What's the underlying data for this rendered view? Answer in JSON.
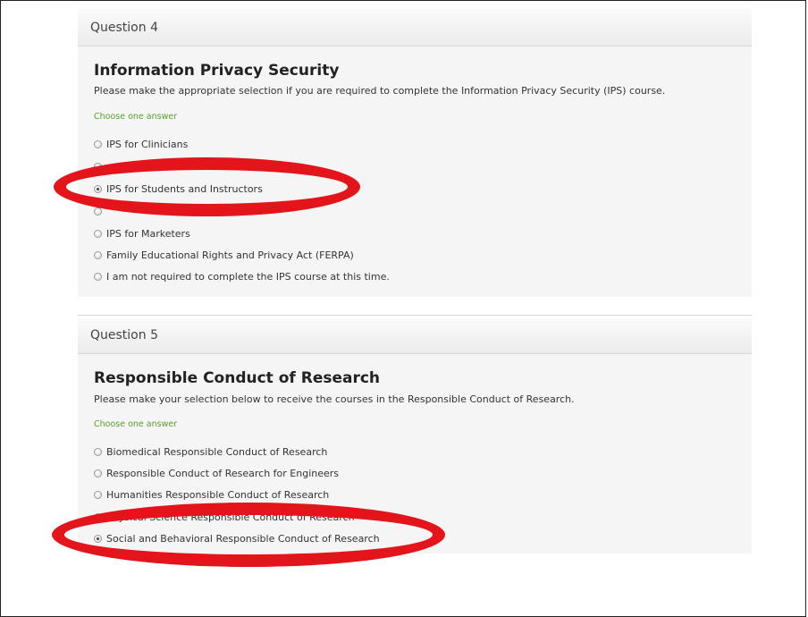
{
  "question4": {
    "header_label": "Question 4",
    "title": "Information Privacy Security",
    "description": "Please make the appropriate selection if you are required to complete the Information Privacy Security (IPS) course.",
    "hint": "Choose one answer",
    "options": [
      {
        "label": "IPS for Clinicians",
        "selected": false
      },
      {
        "label": "",
        "selected": false
      },
      {
        "label": "IPS for Students and Instructors",
        "selected": true
      },
      {
        "label": "",
        "selected": false
      },
      {
        "label": "IPS for Marketers",
        "selected": false
      },
      {
        "label": "Family Educational Rights and Privacy Act (FERPA)",
        "selected": false
      },
      {
        "label": "I am not required to complete the IPS course at this time.",
        "selected": false
      }
    ]
  },
  "question5": {
    "header_label": "Question 5",
    "title": "Responsible Conduct of Research",
    "description": "Please make your selection below to receive the courses in the Responsible Conduct of Research.",
    "hint": "Choose one answer",
    "options": [
      {
        "label": "Biomedical Responsible Conduct of Research",
        "selected": false
      },
      {
        "label": "Responsible Conduct of Research for Engineers",
        "selected": false
      },
      {
        "label": "Humanities Responsible Conduct of Research",
        "selected": false
      },
      {
        "label": "Physical Science Responsible Conduct of Research",
        "selected": false
      },
      {
        "label": "Social and Behavioral Responsible Conduct of Research",
        "selected": true
      }
    ]
  },
  "colors": {
    "annotation": "#e3141a",
    "hint": "#5aa02c",
    "panel_background": "#f5f5f5"
  }
}
